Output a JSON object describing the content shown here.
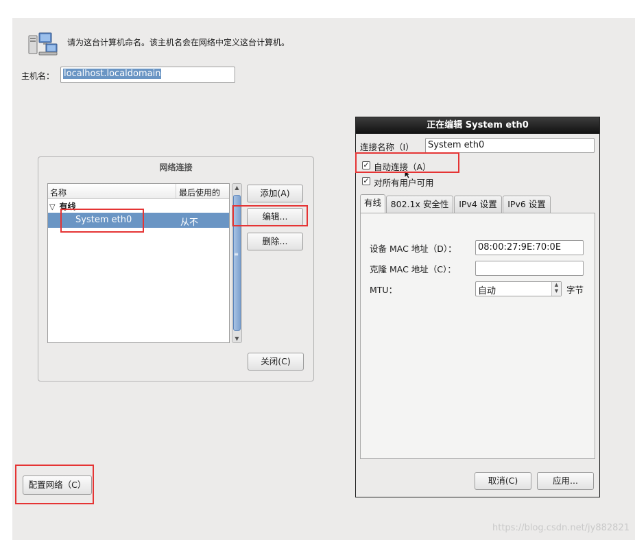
{
  "header": {
    "intro": "请为这台计算机命名。该主机名会在网络中定义这台计算机。",
    "hostname_label": "主机名：",
    "hostname_value": "localhost.localdomain"
  },
  "network_window": {
    "title": "网络连接",
    "columns": [
      "名称",
      "最后使用的"
    ],
    "group": "有线",
    "connection": {
      "name": "System eth0",
      "last_used": "从不"
    },
    "buttons": {
      "add": "添加(A)",
      "edit": "编辑...",
      "delete": "删除...",
      "close": "关闭(C)"
    }
  },
  "configure_button": "配置网络（C）",
  "dialog": {
    "title": "正在编辑 System eth0",
    "conn_name_label": "连接名称（I）",
    "conn_name_value": "System eth0",
    "auto_connect": {
      "label": "自动连接（A）",
      "checked": true
    },
    "all_users": {
      "label": "对所有用户可用",
      "checked": true
    },
    "tabs": [
      "有线",
      "802.1x 安全性",
      "IPv4 设置",
      "IPv6 设置"
    ],
    "active_tab": "有线",
    "device_mac_label": "设备 MAC 地址（D）：",
    "device_mac_value": "08:00:27:9E:70:0E",
    "cloned_mac_label": "克隆 MAC 地址（C）：",
    "cloned_mac_value": "",
    "mtu_label": "MTU：",
    "mtu_value": "自动",
    "mtu_unit": "字节",
    "cancel": "取消(C)",
    "apply": "应用..."
  },
  "watermark": "https://blog.csdn.net/jy882821",
  "colors": {
    "selection": "#6a95c4",
    "highlight_box": "#e53434",
    "dialog_title_bg": "#1e1e1e"
  }
}
